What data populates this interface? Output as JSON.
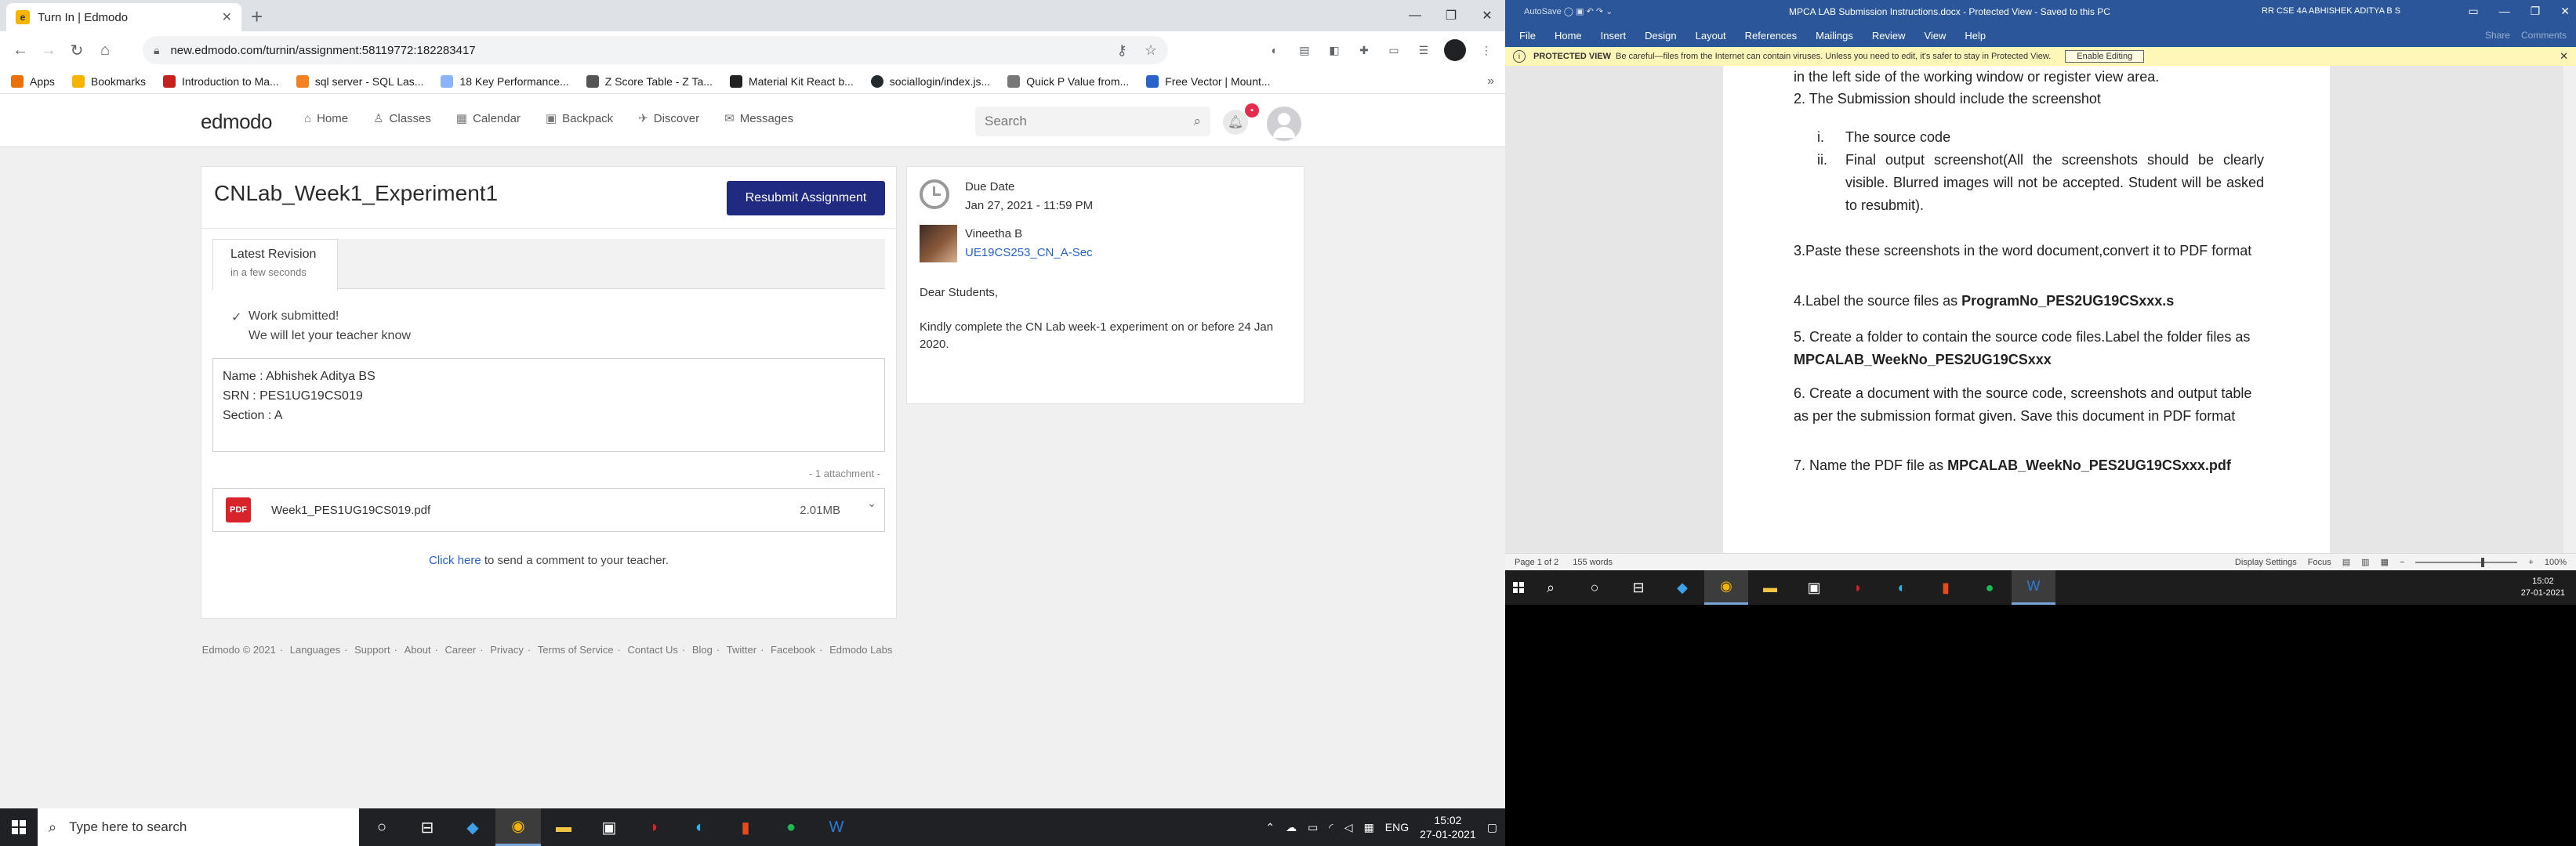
{
  "browser": {
    "tab_title": "Turn In | Edmodo",
    "url": "new.edmodo.com/turnin/assignment:58119772:182283417",
    "bookmarks": [
      {
        "label": "Apps",
        "color": "#e8710a"
      },
      {
        "label": "Bookmarks",
        "color": "#f5b400"
      },
      {
        "label": "Introduction to Ma...",
        "color": "#c5221f"
      },
      {
        "label": "sql server - SQL Las...",
        "color": "#f48024"
      },
      {
        "label": "18 Key Performance...",
        "color": "#8ab4f8"
      },
      {
        "label": "Z Score Table - Z Ta...",
        "color": "#555555"
      },
      {
        "label": "Material Kit React b...",
        "color": "#222222"
      },
      {
        "label": "sociallogin/index.js...",
        "color": "#24292e"
      },
      {
        "label": "Quick P Value from...",
        "color": "#777777"
      },
      {
        "label": "Free Vector | Mount...",
        "color": "#2962c9"
      }
    ]
  },
  "edmodo": {
    "logo": "edmodo",
    "nav": [
      {
        "label": "Home",
        "icon": "⌂"
      },
      {
        "label": "Classes",
        "icon": "♙"
      },
      {
        "label": "Calendar",
        "icon": "▦"
      },
      {
        "label": "Backpack",
        "icon": "▣"
      },
      {
        "label": "Discover",
        "icon": "✈"
      },
      {
        "label": "Messages",
        "icon": "✉"
      }
    ],
    "search_placeholder": "Search",
    "notif_count": "•",
    "assignment": {
      "title": "CNLab_Week1_Experiment1",
      "resubmit_label": "Resubmit Assignment",
      "revision_title": "Latest Revision",
      "revision_time": "in a few seconds",
      "submitted_1": "Work submitted!",
      "submitted_2": "We will let your teacher know",
      "note_lines": [
        "Name : Abhishek Aditya BS",
        "SRN : PES1UG19CS019",
        "Section : A"
      ],
      "attach_count": "- 1 attachment -",
      "file_name": "Week1_PES1UG19CS019.pdf",
      "file_size": "2.01MB",
      "file_badge": "PDF",
      "comment_link": "Click here",
      "comment_rest": " to send a comment to your teacher."
    },
    "side": {
      "due_label": "Due Date",
      "due_value": "Jan 27, 2021 - 11:59 PM",
      "teacher": "Vineetha B",
      "class": "UE19CS253_CN_A-Sec",
      "greeting": "Dear Students,",
      "message": "Kindly complete the CN Lab week-1 experiment on or before 24 Jan 2020."
    },
    "footer": [
      "Edmodo © 2021",
      "Languages",
      "Support",
      "About",
      "Career",
      "Privacy",
      "Terms of Service",
      "Contact Us",
      "Blog",
      "Twitter",
      "Facebook",
      "Edmodo Labs"
    ]
  },
  "taskbar": {
    "search_placeholder": "Type here to search",
    "lang": "ENG",
    "time": "15:02",
    "date": "27-01-2021"
  },
  "word": {
    "doc_title": "MPCA LAB Submission Instructions.docx - Protected View - Saved to this PC",
    "user": "RR CSE 4A ABHISHEK ADITYA B S",
    "autosave": "AutoSave",
    "menu": [
      "File",
      "Home",
      "Insert",
      "Design",
      "Layout",
      "References",
      "Mailings",
      "Review",
      "View",
      "Help"
    ],
    "ribbon_right": [
      "Share",
      "Comments"
    ],
    "protected_title": "PROTECTED VIEW",
    "protected_msg": "Be careful—files from the Internet can contain viruses. Unless you need to edit, it's safer to stay in Protected View.",
    "enable_label": "Enable Editing",
    "line0": "in the left side of the working window or register view area.",
    "p2": "2. The Submission should include the screenshot",
    "sub_i_num": "i.",
    "sub_i": "The source code",
    "sub_ii_num": "ii.",
    "sub_ii": "Final output screenshot(All the screenshots should be clearly visible. Blurred images will not be accepted. Student will be asked to resubmit).",
    "p3": "3.Paste these screenshots in the word document,convert it to PDF format",
    "p4_pre": "4.Label the source files as ",
    "p4_bold": "ProgramNo_PES2UG19CSxxx.s",
    "p5_pre": "5. Create a folder to contain the source code files.Label the folder files as ",
    "p5_bold": "MPCALAB_WeekNo_PES2UG19CSxxx",
    "p6": "6. Create a document with the source code, screenshots and output table as per the submission format given. Save this document in PDF format",
    "p7_pre": "7. Name the PDF file as ",
    "p7_bold": "MPCALAB_WeekNo_PES2UG19CSxxx.pdf",
    "status_page": "Page 1 of 2",
    "status_words": "155 words",
    "status_right": [
      "Display Settings",
      "Focus"
    ],
    "zoom": "100%",
    "time": "15:02",
    "date": "27-01-2021"
  }
}
